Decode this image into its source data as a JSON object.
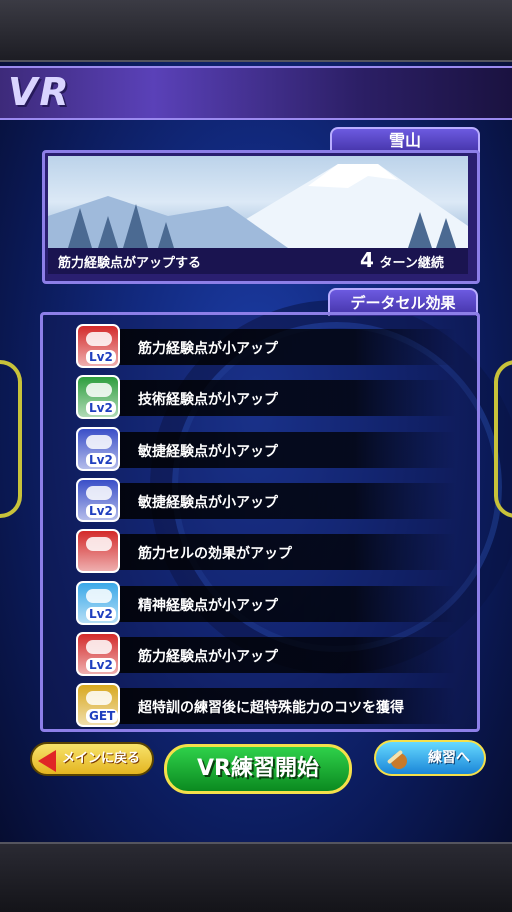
{
  "header": {
    "logo": "VR"
  },
  "stage": {
    "name": "雪山",
    "description": "筋力経験点がアップする",
    "turns_value": "4",
    "turns_unit": "ターン継続"
  },
  "data_cells": {
    "title": "データセル効果",
    "items": [
      {
        "icon": "strength-lv2-icon",
        "icon_color": "#d32a2a",
        "badge": "Lv2",
        "text": "筋力経験点が小アップ"
      },
      {
        "icon": "technique-lv2-icon",
        "icon_color": "#2e9e3e",
        "badge": "Lv2",
        "text": "技術経験点が小アップ"
      },
      {
        "icon": "agility-lv2-icon",
        "icon_color": "#3a4fc8",
        "badge": "Lv2",
        "text": "敏捷経験点が小アップ"
      },
      {
        "icon": "agility-lv2-icon",
        "icon_color": "#3a4fc8",
        "badge": "Lv2",
        "text": "敏捷経験点が小アップ"
      },
      {
        "icon": "strength-cell-boost-icon",
        "icon_color": "#d32a2a",
        "badge": "",
        "text": "筋力セルの効果がアップ"
      },
      {
        "icon": "spirit-lv2-icon",
        "icon_color": "#3aa8e8",
        "badge": "Lv2",
        "text": "精神経験点が小アップ"
      },
      {
        "icon": "strength-lv2-icon",
        "icon_color": "#d32a2a",
        "badge": "Lv2",
        "text": "筋力経験点が小アップ"
      },
      {
        "icon": "get-star-icon",
        "icon_color": "#d8a820",
        "badge": "GET",
        "text": "超特訓の練習後に超特殊能力のコツを獲得"
      }
    ]
  },
  "buttons": {
    "back_label": "メインに戻る",
    "start_label": "VR練習開始",
    "practice_label": "練習へ"
  }
}
